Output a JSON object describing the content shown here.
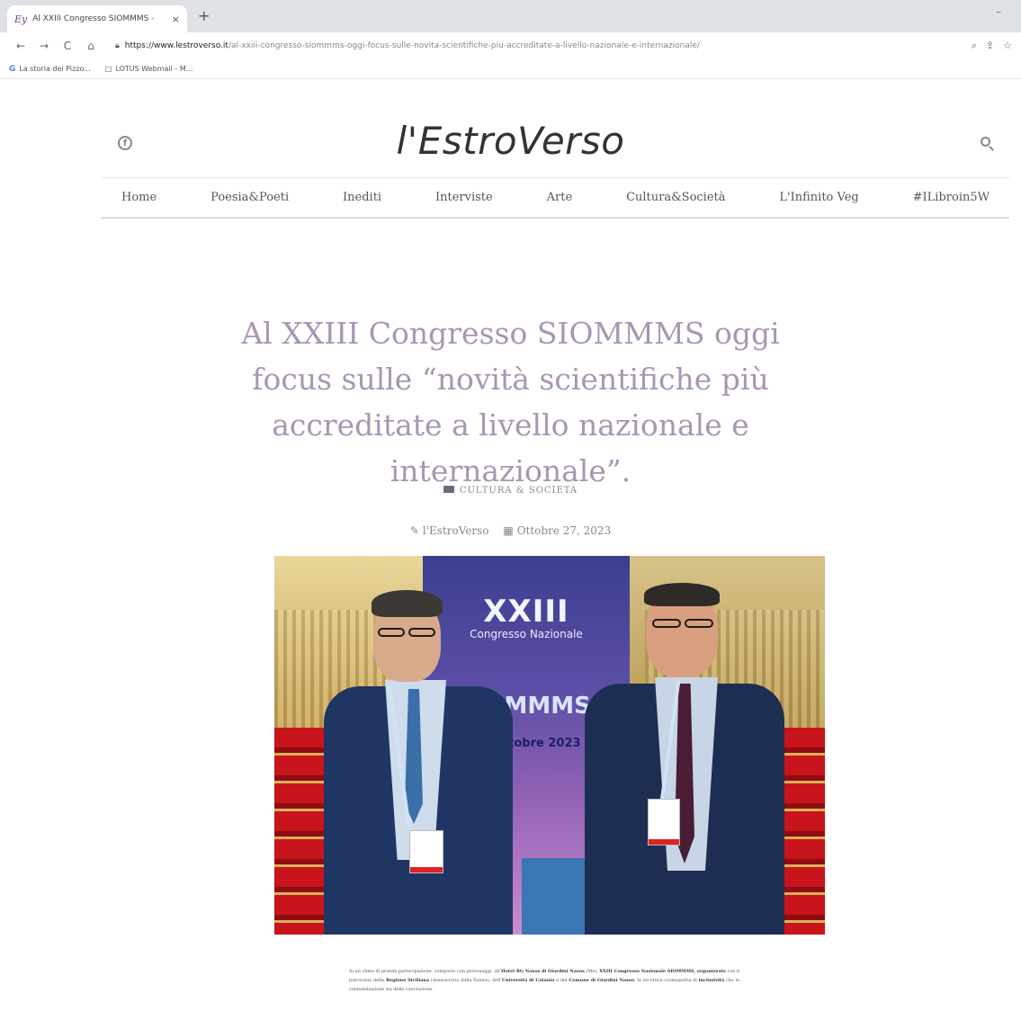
{
  "browser": {
    "tab_title": "Al XXIII Congresso SIOMMMS -",
    "tab_favicon": "Ey",
    "new_tab_label": "+",
    "minimize_label": "–",
    "url_host": "https://www.lestroverso.it",
    "url_path": "/al-xxiii-congresso-siommms-oggi-focus-sulle-novita-scientifiche-piu-accreditate-a-livello-nazionale-e-internazionale/",
    "nav": {
      "back": "←",
      "forward": "→",
      "reload": "C",
      "home": "⌂"
    },
    "toolbar_icons": [
      "zoom-icon",
      "share-icon",
      "star-icon"
    ],
    "bookmarks": [
      {
        "label": "La storia dei Pizzo...",
        "icon": "G"
      },
      {
        "label": "LOTUS Webmail - M...",
        "icon": "□"
      }
    ]
  },
  "site": {
    "logo": "l'EstroVerso",
    "nav": [
      "Home",
      "Poesia&Poeti",
      "Inediti",
      "Interviste",
      "Arte",
      "Cultura&Società",
      "L'Infinito Veg",
      "#ILibroin5W"
    ]
  },
  "article": {
    "title": "Al XXIII Congresso SIOMMMS oggi focus sulle “novità scientifiche più accreditate a livello nazionale e internazionale”.",
    "category": "CULTURA & SOCIETÀ",
    "author": "l'EstroVerso",
    "date": "Ottobre 27, 2023",
    "photo": {
      "banner_big": "XXIII",
      "banner_sub": "Congresso Nazionale",
      "banner_siom": "SIOMMMS",
      "banner_date": "ottobre 2023"
    },
    "body_p1_a": "In un clima di grande partecipazione, composto con personaggi, all’",
    "body_p1_b": "Hotel RG Naxos di Giardini Naxos",
    "body_p1_c": " (Me), ",
    "body_p1_d": "XXIII Congresso Nazionale SIOMMMS, organizzato",
    "body_p1_e": " con il patrocinio della ",
    "body_p1_f": "Regione Siciliana",
    "body_p1_g": " (Assessorato della Salute), dell’",
    "body_p1_h": "Università di Catania",
    "body_p1_i": " e del ",
    "body_p1_j": "Comune di Giardini Naxos",
    "body_p1_k": ", le un’ottica cosmopolita di ",
    "body_p1_l": "inclusività",
    "body_p1_m": " che la contaminazione sia della conclusione."
  }
}
